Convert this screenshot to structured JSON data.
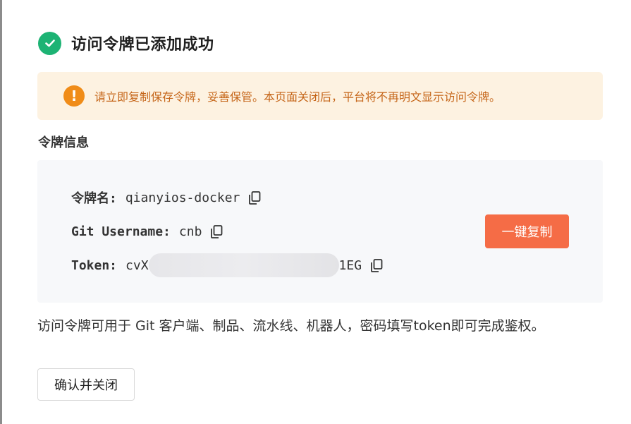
{
  "dialog": {
    "title": "访问令牌已添加成功",
    "success_icon": "check-circle-icon"
  },
  "warning": {
    "icon": "exclamation-icon",
    "icon_glyph": "!",
    "text": "请立即复制保存令牌，妥善保管。本页面关闭后，平台将不再明文显示访问令牌。"
  },
  "token_info": {
    "section_label": "令牌信息",
    "name_label": "令牌名:",
    "name_value": "qianyios-docker",
    "username_label": "Git Username:",
    "username_value": "cnb",
    "token_label": "Token:",
    "token_prefix": "cvX",
    "token_suffix": "1EG",
    "copy_icon": "copy-icon",
    "copy_all_label": "一键复制"
  },
  "hint": "访问令牌可用于 Git 客户端、制品、流水线、机器人，密码填写token即可完成鉴权。",
  "footer": {
    "confirm_label": "确认并关闭"
  },
  "colors": {
    "success": "#1db374",
    "warning_bg": "#fdf2e1",
    "warning_icon": "#f08c18",
    "warning_text": "#c56518",
    "primary_button": "#f56c46"
  }
}
